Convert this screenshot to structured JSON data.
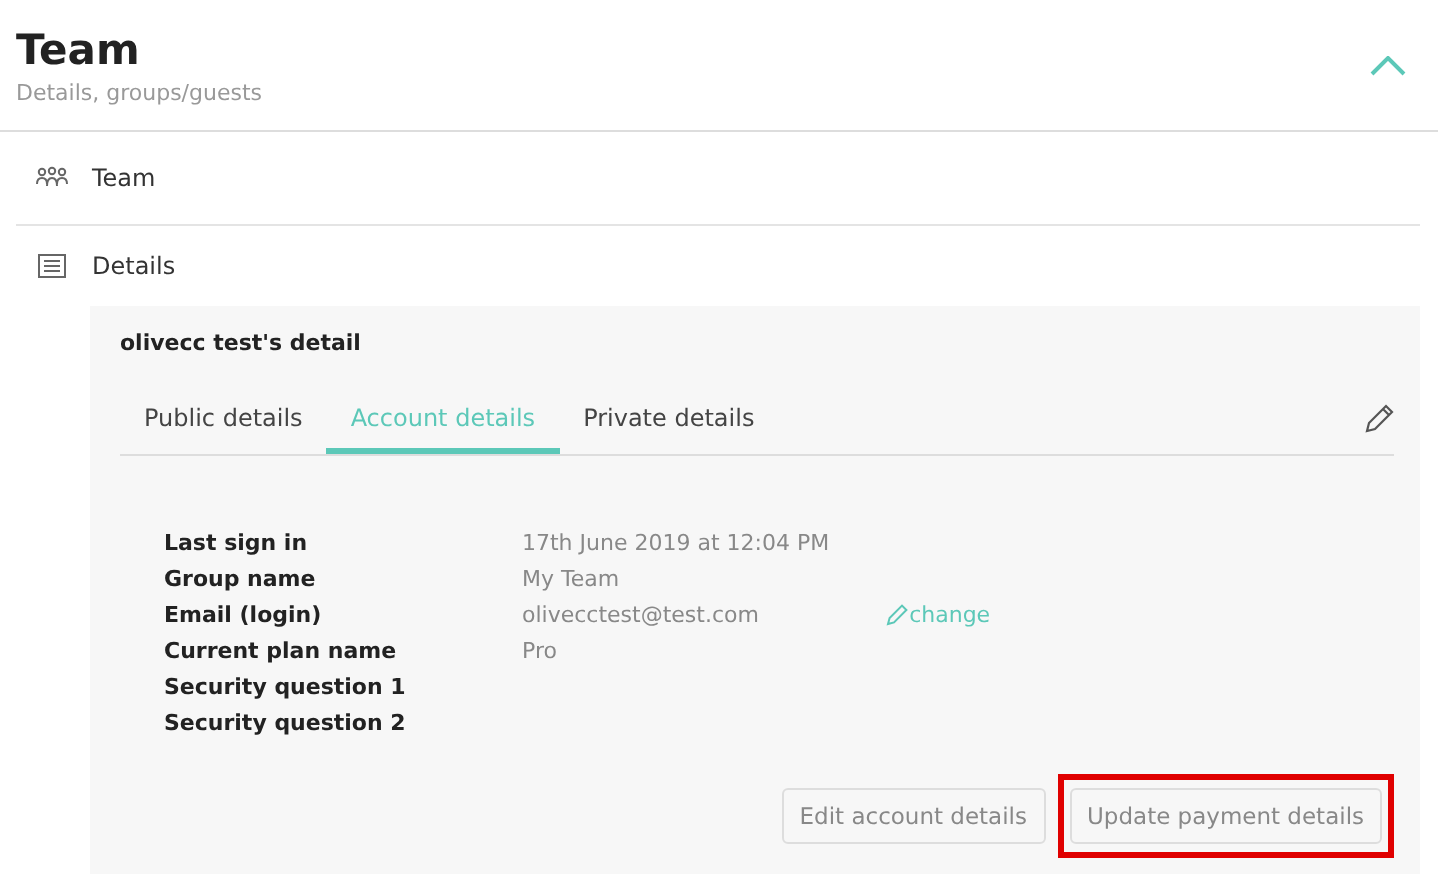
{
  "header": {
    "title": "Team",
    "subtitle": "Details, groups/guests",
    "expanded": true
  },
  "nav": [
    {
      "kind": "people",
      "label": "Team"
    },
    {
      "kind": "list",
      "label": "Details"
    }
  ],
  "card": {
    "title": "olivecc test's detail",
    "tabs": [
      {
        "label": "Public details",
        "selected": false
      },
      {
        "label": "Account details",
        "selected": true
      },
      {
        "label": "Private details",
        "selected": false
      }
    ],
    "fields": [
      {
        "label": "Last sign in",
        "value": "17th June 2019 at 12:04 PM"
      },
      {
        "label": "Group name",
        "value": "My Team"
      },
      {
        "label": "Email (login)",
        "value": "olivecctest@test.com",
        "link": "change"
      },
      {
        "label": "Current plan name",
        "value": "Pro"
      },
      {
        "label": "Security question 1"
      },
      {
        "label": "Security question 2"
      }
    ],
    "buttons": [
      {
        "label": "Edit account details",
        "highlighted": false
      },
      {
        "label": "Update payment details",
        "highlighted": true
      }
    ]
  }
}
